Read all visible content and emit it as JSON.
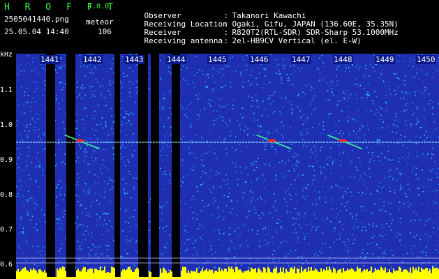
{
  "app": {
    "name": "H R O F F T",
    "version": "1.0.0"
  },
  "file": {
    "name": "2505041440.png",
    "datetime": "25.05.04 14:40"
  },
  "meteor": {
    "label": "meteor",
    "count": "106"
  },
  "info": [
    {
      "key": "Observer",
      "value": "Takanori Kawachi"
    },
    {
      "key": "Receiving Location",
      "value": "Ogaki, Gifu, JAPAN (136.60E, 35.35N)"
    },
    {
      "key": "Receiver",
      "value": "R820T2(RTL-SDR) SDR-Sharp 53.1000MHz"
    },
    {
      "key": "Receiving antenna",
      "value": "2el-HB9CV Vertical (el. E-W)"
    }
  ],
  "chart_data": {
    "type": "heatmap",
    "ylabel": "kHz",
    "y_ticks": [
      "1.1",
      "1.0",
      "0.9",
      "0.8",
      "0.7",
      "0.6"
    ],
    "ylim": [
      0.57,
      1.17
    ],
    "x_ticks": [
      "1441",
      "1442",
      "1443",
      "1444",
      "1445",
      "1446",
      "1447",
      "1448",
      "1449",
      "1450"
    ],
    "carrier_khz": 0.92,
    "meteor_echoes": [
      {
        "minute": 1442.3,
        "freq": 0.925
      },
      {
        "minute": 1446.9,
        "freq": 0.925
      },
      {
        "minute": 1448.6,
        "freq": 0.925
      }
    ],
    "colors": {
      "background": "#1f2fb4",
      "noise_bright": "#2fd0ff",
      "noise_mid": "#1e88ff",
      "gap": "#000000",
      "echo": "#ff2020",
      "baseline": "#ffff00"
    }
  }
}
